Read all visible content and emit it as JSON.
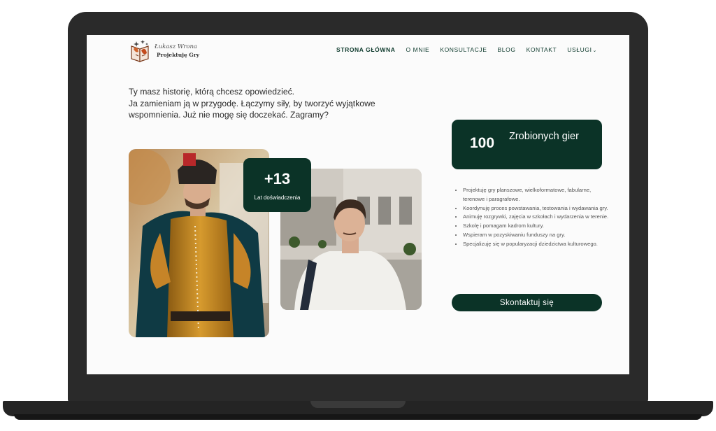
{
  "brand": {
    "name_script": "Łukasz Wrona",
    "tagline": "Projektuję Gry",
    "logo_icon": "book-dragon-logo"
  },
  "nav": {
    "items": [
      {
        "label": "STRONA GŁÓWNA",
        "active": true
      },
      {
        "label": "O MNIE"
      },
      {
        "label": "KONSULTACJE"
      },
      {
        "label": "BLOG"
      },
      {
        "label": "KONTAKT"
      },
      {
        "label": "USŁUGI",
        "icon": "chevron-down-icon"
      }
    ]
  },
  "intro": {
    "line1": "Ty masz historię, którą chcesz opowiedzieć.",
    "line2": "Ja zamieniam ją w przygodę. Łączymy siły, by tworzyć wyjątkowe wspomnienia. Już nie mogę się doczekać. Zagramy?"
  },
  "experience": {
    "value": "+13",
    "label": "Lat doświadczenia"
  },
  "stats": {
    "value": "100",
    "label": "Zrobionych gier"
  },
  "services": [
    "Projektuję gry planszowe, wielkoformatowe, fabularne, terenowe i paragrafowe.",
    "Koordynuję proces powstawania, testowania i wydawania gry.",
    "Animuję rozgrywki, zajęcia w szkołach i wydarzenia w terenie.",
    "Szkolę i pomagam kadrom kultury.",
    "Wspieram w pozyskiwaniu funduszy na gry.",
    "Specjalizuję się w popularyzacji dziedzictwa kulturowego."
  ],
  "cta": {
    "label": "Skontaktuj się"
  },
  "colors": {
    "accent": "#0b3327",
    "frame": "#2a2a2a",
    "background": "#fbfbfb"
  }
}
